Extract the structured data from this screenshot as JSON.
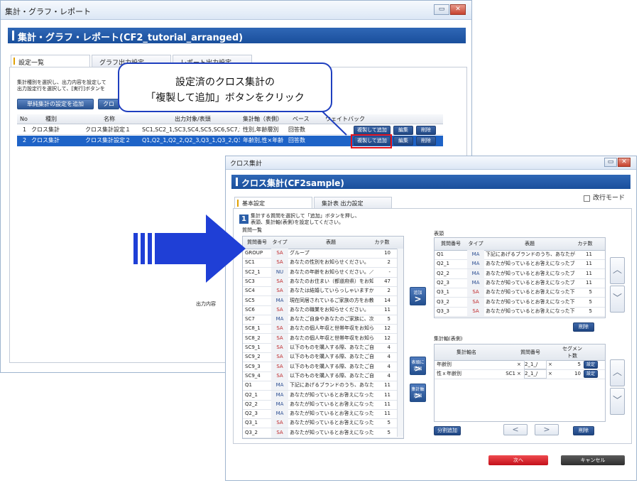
{
  "back_window": {
    "title": "集計・グラフ・レポート",
    "header": "集計・グラフ・レポート(CF2_tutorial_arranged)",
    "tabs": [
      "設定一覧",
      "グラフ出力設定",
      "レポート出力設定"
    ],
    "instruction1": "集計種別を選択し、出力内容を設定して",
    "instruction2": "出力設定行を選択して、[実行]ボタンを",
    "btn_add_simple": "単純集計の設定を追加",
    "btn_add_cross": "クロ",
    "columns": [
      "No",
      "種別",
      "名称",
      "出力対象/表頭",
      "集計軸（表側）",
      "ベース",
      "ウェイトバック"
    ],
    "rows": [
      {
        "no": "1",
        "kind": "クロス集計",
        "name": "クロス集計設定１",
        "target": "SC1,SC2_1,SC3,SC4,SC5,SC6,SC7,SC",
        "axis": "性別,年齢層別",
        "base": "回答数",
        "copy": "複製して追加",
        "edit": "編集",
        "del": "削除"
      },
      {
        "no": "2",
        "kind": "クロス集計",
        "name": "クロス集計設定２",
        "target": "Q1,Q2_1,Q2_2,Q2_3,Q3_1,Q3_2,Q3",
        "axis": "年齢別,性×年齢",
        "base": "回答数",
        "copy": "複製して追加",
        "edit": "編集",
        "del": "削除"
      }
    ],
    "output_label": "出力内容"
  },
  "callout": {
    "line1": "設定済のクロス集計の",
    "line2": "「複製して追加」ボタンをクリック"
  },
  "front_window": {
    "title": "クロス集計",
    "header": "クロス集計(CF2sample)",
    "tabs": [
      "基本設定",
      "集計表 出力設定"
    ],
    "toggle_label": "改行モード",
    "step_number": "1",
    "step_text1": "集計する質問を選択して「追加」ボタンを押し、",
    "step_text2": "表頭、集計軸(表側)を設定してください。",
    "question_list_label": "質問一覧",
    "q_columns": [
      "質問番号",
      "タイプ",
      "表題",
      "カテ数"
    ],
    "questions": [
      {
        "id": "GROUP",
        "type": "SA",
        "title": "グループ",
        "n": "10"
      },
      {
        "id": "SC1",
        "type": "SA",
        "title": "あなたの性別をお知らせください。",
        "n": "2"
      },
      {
        "id": "SC2_1",
        "type": "NU",
        "title": "あなたの年齢をお知らせください。／年",
        "n": "-"
      },
      {
        "id": "SC3",
        "type": "SA",
        "title": "あなたのお住まい（都道府県）をお知ら",
        "n": "47"
      },
      {
        "id": "SC4",
        "type": "SA",
        "title": "あなたは結婚していらっしゃいますか。",
        "n": "2"
      },
      {
        "id": "SC5",
        "type": "MA",
        "title": "現在同居されているご家族の方をお教え",
        "n": "14"
      },
      {
        "id": "SC6",
        "type": "SA",
        "title": "あなたの職業をお知らせください。",
        "n": "11"
      },
      {
        "id": "SC7",
        "type": "MA",
        "title": "あなたご自身やあなたのご家族に、次の",
        "n": "5"
      },
      {
        "id": "SC8_1",
        "type": "SA",
        "title": "あなたの個人年収と世帯年収をお知らせ",
        "n": "12"
      },
      {
        "id": "SC8_2",
        "type": "SA",
        "title": "あなたの個人年収と世帯年収をお知らせ",
        "n": "12"
      },
      {
        "id": "SC9_1",
        "type": "SA",
        "title": "以下のものを購入する際、あなたご自身",
        "n": "4"
      },
      {
        "id": "SC9_2",
        "type": "SA",
        "title": "以下のものを購入する際、あなたご自身",
        "n": "4"
      },
      {
        "id": "SC9_3",
        "type": "SA",
        "title": "以下のものを購入する際、あなたご自身",
        "n": "4"
      },
      {
        "id": "SC9_4",
        "type": "SA",
        "title": "以下のものを購入する際、あなたご自身",
        "n": "4"
      },
      {
        "id": "Q1",
        "type": "MA",
        "title": "下記にあげるブランドのうち、あなたが",
        "n": "11"
      },
      {
        "id": "Q2_1",
        "type": "MA",
        "title": "あなたが知っているとお答えになったブ",
        "n": "11"
      },
      {
        "id": "Q2_2",
        "type": "MA",
        "title": "あなたが知っているとお答えになったブ",
        "n": "11"
      },
      {
        "id": "Q2_3",
        "type": "MA",
        "title": "あなたが知っているとお答えになったブ",
        "n": "11"
      },
      {
        "id": "Q3_1",
        "type": "SA",
        "title": "あなたが知っているとお答えになった下",
        "n": "5"
      },
      {
        "id": "Q3_2",
        "type": "SA",
        "title": "あなたが知っているとお答えになった下",
        "n": "5"
      }
    ],
    "add_head_label": "追加",
    "add_axis_label": "表頭に追加",
    "add_axis2_label": "集計軸追加",
    "head_label": "表頭",
    "head_columns": [
      "質問番号",
      "タイプ",
      "表題",
      "カテ数"
    ],
    "head_rows": [
      {
        "id": "Q1",
        "type": "MA",
        "title": "下記にあげるブランドのうち、あなたが知っ",
        "n": "11"
      },
      {
        "id": "Q2_1",
        "type": "MA",
        "title": "あなたが知っているとお答えになったブラン",
        "n": "11"
      },
      {
        "id": "Q2_2",
        "type": "MA",
        "title": "あなたが知っているとお答えになったブラン",
        "n": "11"
      },
      {
        "id": "Q2_3",
        "type": "MA",
        "title": "あなたが知っているとお答えになったブラン",
        "n": "11"
      },
      {
        "id": "Q3_1",
        "type": "SA",
        "title": "あなたが知っているとお答えになった下記の",
        "n": "5"
      },
      {
        "id": "Q3_2",
        "type": "SA",
        "title": "あなたが知っているとお答えになった下記の",
        "n": "5"
      },
      {
        "id": "Q3_3",
        "type": "SA",
        "title": "あなたが知っているとお答えになった下記の",
        "n": "5"
      }
    ],
    "head_delete": "削除",
    "axis_label": "集計軸(表側)",
    "axis_columns": [
      "集計軸名",
      "質問番号",
      "セグメント数"
    ],
    "axis_rows": [
      {
        "name": "年齢別",
        "q1": "",
        "q2": "2_1_/",
        "x1": "×",
        "x2": "×",
        "n": "5",
        "btn": "設定"
      },
      {
        "name": "性ｘ年齢別",
        "q1": "SC1",
        "q2": "2_1_/",
        "x1": "×",
        "x2": "×",
        "n": "10",
        "btn": "設定"
      }
    ],
    "split_label": "分割追加",
    "axis_delete": "削除",
    "next_label": "次へ",
    "cancel_label": "キャンセル"
  },
  "colors": {
    "header_blue": "#1a4f9c",
    "selection_blue": "#1e63c7",
    "highlight_red": "#e5121a",
    "arrow_blue": "#1f3fd6",
    "next_red": "#d7141c",
    "cancel_dark": "#3a3a3a"
  }
}
